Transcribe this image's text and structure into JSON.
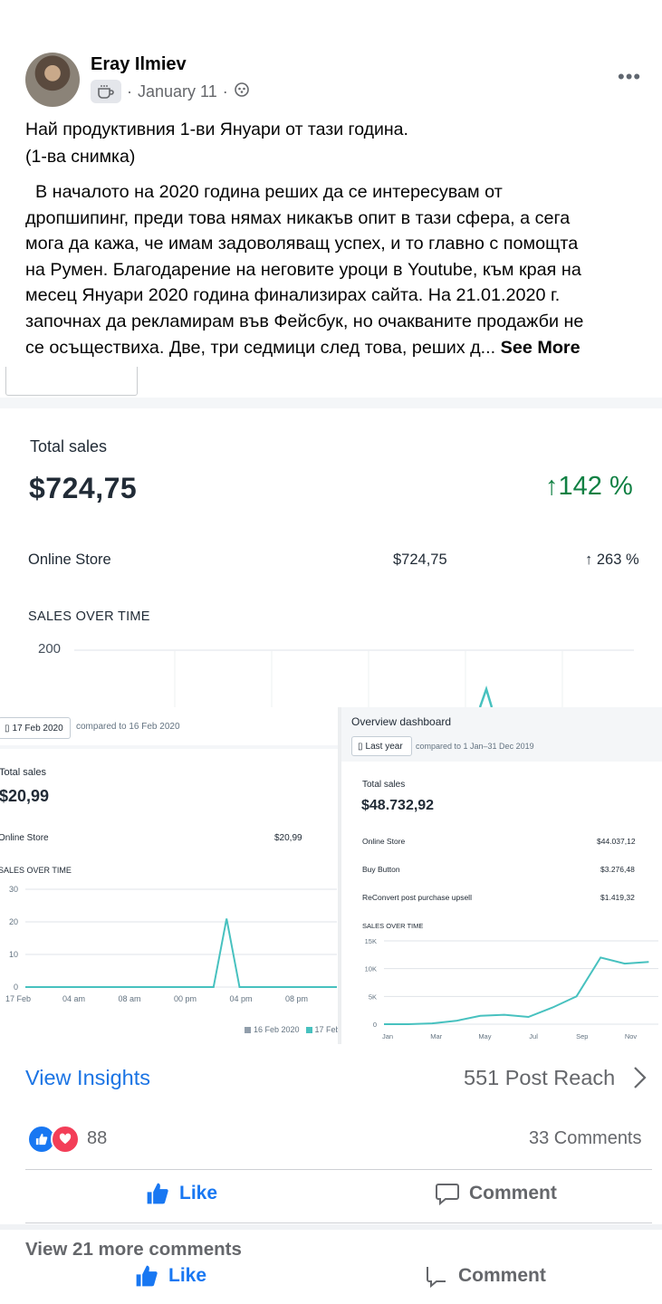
{
  "post": {
    "author": "Eray Ilmiev",
    "date": "January 11",
    "separator": "·",
    "title_line1": "Най  продуктивния 1-ви Януари от тази година.",
    "title_line2": "(1-ва снимка)",
    "body_lines": [
      "  В началото на 2020 година реших да се интересувам от",
      "дропшипинг, преди това нямах никакъв опит в тази сфера, а сега",
      "мога да кажа, че имам задоволяващ успех, и то главно с помощта",
      "на Румен. Благодарение на неговите уроци в Youtube, към края на",
      "месец Януари 2020 година финализирах сайта. На 21.01.2020 г.",
      "започнах да рекламирам във Фейсбук, но очакваните продажби не",
      "се осъществиха. Две, три седмици след това, реших д..."
    ],
    "see_more": "See More"
  },
  "shot1": {
    "total_sales_label": "Total sales",
    "total_sales_value": "$724,75",
    "total_change": "142 %",
    "online_store_label": "Online Store",
    "online_store_value": "$724,75",
    "online_store_change": "263 %",
    "sales_over_time_label": "SALES OVER TIME",
    "y_tick": "200"
  },
  "shot2": {
    "date_button": "17 Feb 2020",
    "compared": "compared to 16 Feb 2020",
    "total_sales_label": "Total sales",
    "total_sales_value": "$20,99",
    "online_store_label": "Online Store",
    "online_store_value": "$20,99",
    "sales_over_time_label": "SALES OVER TIME",
    "legend": [
      "16 Feb 2020",
      "17 Feb"
    ]
  },
  "shot3": {
    "title": "Overview dashboard",
    "date_button": "Last year",
    "compared": "compared to 1 Jan–31 Dec 2019",
    "total_sales_label": "Total sales",
    "total_sales_value": "$48.732,92",
    "rows": [
      {
        "label": "Online Store",
        "value": "$44.037,12"
      },
      {
        "label": "Buy Button",
        "value": "$3.276,48"
      },
      {
        "label": "ReConvert post purchase upsell",
        "value": "$1.419,32"
      }
    ],
    "sales_over_time_label": "SALES OVER TIME"
  },
  "chart_data": [
    {
      "type": "line",
      "title": "SALES OVER TIME",
      "x": [
        "17 Feb",
        "04 am",
        "08 am",
        "00 pm",
        "04 pm",
        "08 pm"
      ],
      "x_ticks": [
        "17 Feb",
        "04 am",
        "08 am",
        "00 pm",
        "04 pm",
        "08 pm"
      ],
      "y_ticks": [
        "0",
        "10",
        "20",
        "30"
      ],
      "ylim": [
        0,
        30
      ],
      "series": [
        {
          "name": "17 Feb",
          "points": [
            [
              0,
              0
            ],
            [
              14.5,
              0
            ],
            [
              15.5,
              21
            ],
            [
              16.5,
              0
            ],
            [
              24,
              0
            ]
          ]
        }
      ],
      "grid": true,
      "legend": "bottom-right"
    },
    {
      "type": "line",
      "title": "SALES OVER TIME",
      "x_ticks": [
        "Jan",
        "Mar",
        "May",
        "Jul",
        "Sep",
        "Nov"
      ],
      "y_ticks": [
        "0",
        "5K",
        "10K",
        "15K"
      ],
      "ylim": [
        0,
        15000
      ],
      "series": [
        {
          "name": "",
          "points": [
            [
              0,
              0
            ],
            [
              1,
              0
            ],
            [
              2,
              150
            ],
            [
              3,
              600
            ],
            [
              4,
              1500
            ],
            [
              5,
              1700
            ],
            [
              6,
              1300
            ],
            [
              7,
              3000
            ],
            [
              8,
              5000
            ],
            [
              9,
              12000
            ],
            [
              10,
              10900
            ],
            [
              11,
              11200
            ]
          ]
        }
      ],
      "grid": true
    }
  ],
  "footer": {
    "view_insights": "View Insights",
    "post_reach": "551 Post Reach",
    "reaction_count": "88",
    "comments": "33 Comments",
    "like": "Like",
    "comment": "Comment",
    "view_more_comments": "View 21 more comments"
  },
  "colors": {
    "facebook_blue": "#1b74e4",
    "shopify_teal": "#47c1bf",
    "shopify_green": "#108043",
    "love_red": "#f33e58"
  }
}
